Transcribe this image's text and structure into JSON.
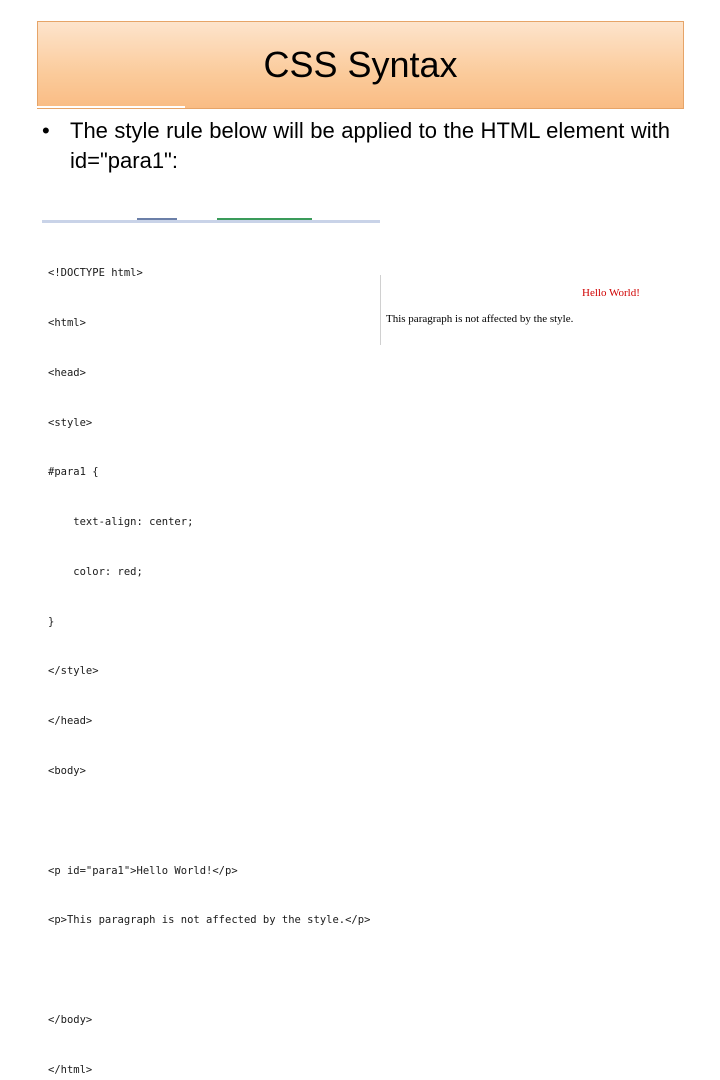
{
  "slide": {
    "title": "CSS Syntax",
    "bullet_symbol": "•",
    "bullet_text": "The style rule below will be applied to the HTML element with id=\"para1\":"
  },
  "code_lines": [
    "<!DOCTYPE html>",
    "<html>",
    "<head>",
    "<style>",
    "#para1 {",
    "    text-align: center;",
    "    color: red;",
    "}",
    "</style>",
    "</head>",
    "<body>",
    "",
    "<p id=\"para1\">Hello World!</p>",
    "<p>This paragraph is not affected by the style.</p>",
    "",
    "</body>",
    "</html>"
  ],
  "render": {
    "hello": "Hello World!",
    "paragraph": "This paragraph is not affected by the style."
  },
  "colors": {
    "title_bg": "#fbcb9b",
    "hello_text": "#d00000"
  }
}
